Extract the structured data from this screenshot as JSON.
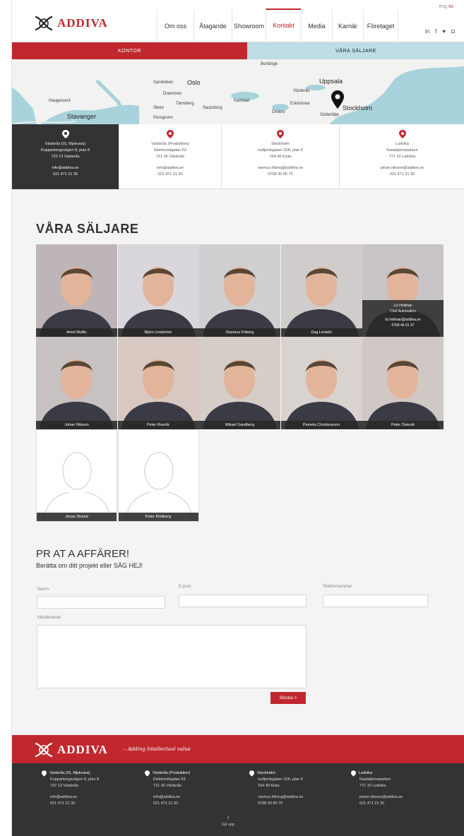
{
  "header": {
    "brand": "ADDIVA",
    "nav": [
      "Om oss",
      "Åtagande",
      "Showroom",
      "Kontakt",
      "Media",
      "Karriär",
      "Företaget"
    ],
    "active_nav": "Kontakt",
    "lang": {
      "current": "eng",
      "alt": "sv"
    },
    "social_icons": [
      "linkedin-icon",
      "facebook-icon",
      "twitter-icon",
      "instagram-icon"
    ]
  },
  "contact_tabs": {
    "kontor": "KONTOR",
    "saljare": "VÅRA SÄLJARE",
    "active": "KONTOR"
  },
  "map": {
    "labels": [
      "Borlänge",
      "Sandviken",
      "Oslo",
      "Uppsala",
      "Drammen",
      "Västerås",
      "Haugesund",
      "Tønsberg",
      "Karlstad",
      "Eskilstuna",
      "Stockholm",
      "Stavanger",
      "Skien",
      "Sarpsborg",
      "Örebro",
      "Södertälje",
      "Porsgrunn"
    ],
    "pin_label": "Stockholm"
  },
  "offices": [
    {
      "city": "Västerås (IS, Mjukvara)",
      "street": "Kopparbergsvägen 8, plan 8",
      "zip": "722 13 Västerås",
      "email": "info@addiva.se",
      "phone": "021 471 21 30",
      "highlighted": true
    },
    {
      "city": "Västerås (Produktion)",
      "street": "Elektronikgatan 53",
      "zip": "721 36 Västerås",
      "email": "info@addiva.se",
      "phone": "021 471 21 30",
      "highlighted": false
    },
    {
      "city": "Stockholm",
      "street": "Isafjordsgatan 22A, plan 5",
      "zip": "164 40 Kista",
      "email": "rasmus.friberg@addiva.se",
      "phone": "0768 30 80 70",
      "highlighted": false
    },
    {
      "city": "Ludvika",
      "street": "Kastaljärneparken",
      "zip": "771 32 Ludvika",
      "email": "johan.nilsson@addiva.se",
      "phone": "021 471 21 30",
      "highlighted": false
    }
  ],
  "sellers": {
    "title": "VÅRA SÄLJARE",
    "people": [
      {
        "name": "Amel Muftic",
        "bg": "#bdb5b8"
      },
      {
        "name": "Björn Lindström",
        "bg": "#d9d6dc"
      },
      {
        "name": "Rasmus Friberg",
        "bg": "#cfcfd2"
      },
      {
        "name": "Dag Lindahl",
        "bg": "#d0cccb"
      },
      {
        "name": "Liz Hellman",
        "bg": "#c9c4c5",
        "role": "Chef Automation",
        "email": "liz.hellman@addiva.se",
        "phone": "0768 46 91 37"
      },
      {
        "name": "Johan Nilsson",
        "bg": "#c7c2c1"
      },
      {
        "name": "Peter Roeritz",
        "bg": "#d8c8c2"
      },
      {
        "name": "Mikael Sandberg",
        "bg": "#d5cdc8"
      },
      {
        "name": "Pamela Christensson",
        "bg": "#d9d3cf"
      },
      {
        "name": "Peter Östevik",
        "bg": "#cfc8c5"
      },
      {
        "name": "Jonas Strand",
        "bg": "#ffffff",
        "placeholder": true
      },
      {
        "name": "Peter Klintberg",
        "bg": "#ffffff",
        "placeholder": true
      }
    ]
  },
  "form": {
    "title": "PR AT A  AFFÄRER!",
    "subtitle": "Berätta om ditt projekt eller SÄG HEJ!",
    "name_label": "Namn",
    "email_label": "E-post",
    "phone_label": "Telefonnummer",
    "message_label": "Meddelande",
    "submit": "Skicka >"
  },
  "footer": {
    "brand": "ADDIVA",
    "tagline": "– Adding Intellectual value",
    "to_top": "Gå upp",
    "to_top_icon": "arrow-up-icon"
  },
  "colors": {
    "brand_red": "#c0282d",
    "dark": "#333333",
    "map_water": "#a8d3dc"
  }
}
